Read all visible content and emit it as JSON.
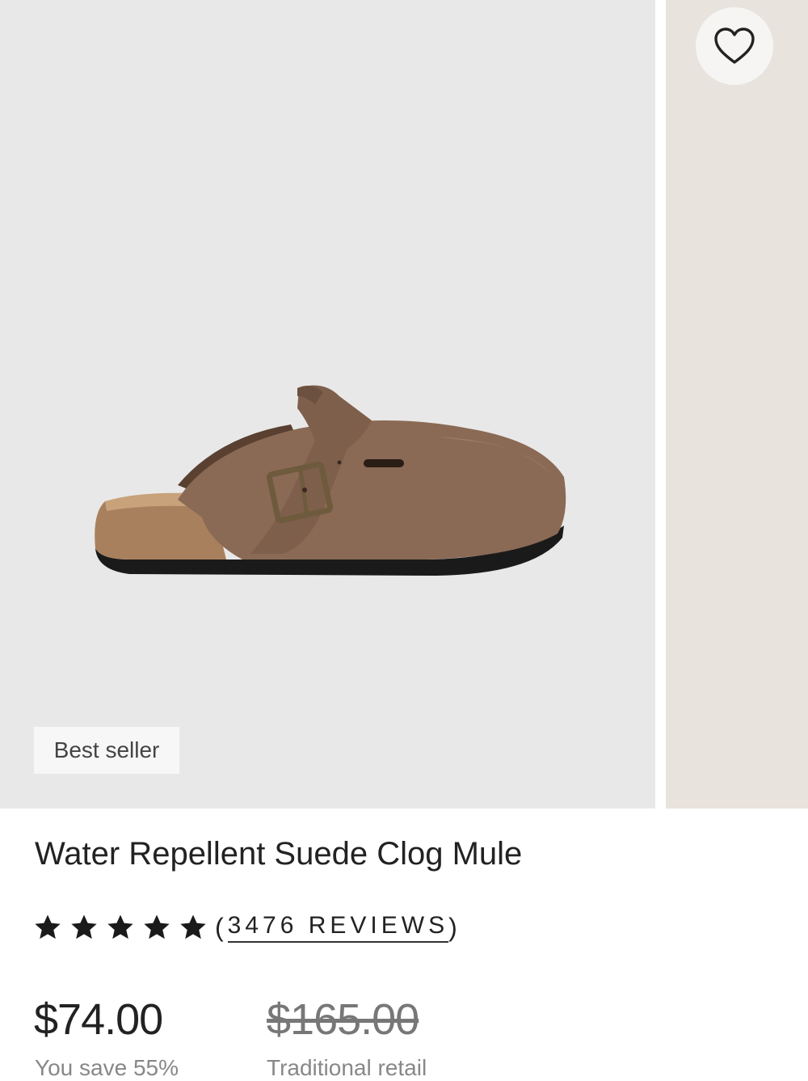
{
  "product": {
    "badge": "Best seller",
    "title": "Water Repellent Suede Clog Mule",
    "rating": 5,
    "reviews_open": "(",
    "reviews_label": "3476 REVIEWS",
    "reviews_close": ")",
    "price": "$74.00",
    "savings": "You save 55%",
    "retail_price": "$165.00",
    "retail_label": "Traditional retail"
  },
  "icons": {
    "favorite": "heart-outline-icon",
    "star": "star-filled-icon"
  },
  "colors": {
    "image_background": "#e9e8e8",
    "suede": "#8a6a55",
    "sole": "#1a1a1a",
    "text": "#222222",
    "muted_text": "#888888"
  }
}
